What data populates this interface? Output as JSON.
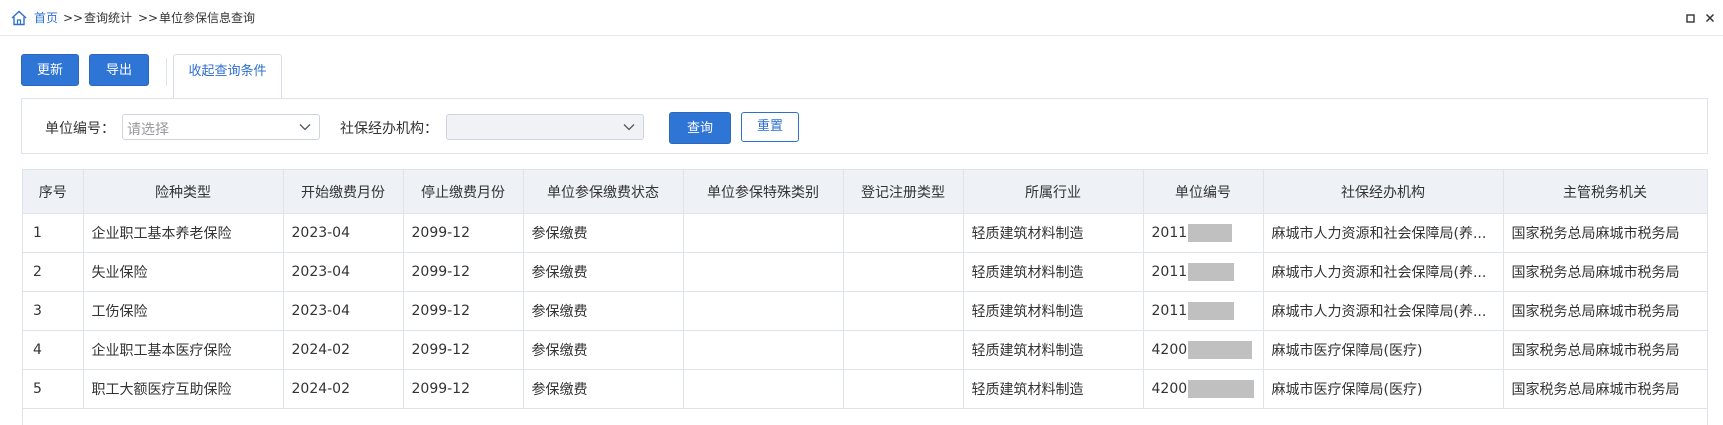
{
  "breadcrumb": {
    "home": "首页",
    "sep1": ">>",
    "level2": "查询统计",
    "sep2": ">>",
    "current": "单位参保信息查询"
  },
  "toolbar": {
    "refresh_label": "更新",
    "export_label": "导出",
    "collapse_tab_label": "收起查询条件"
  },
  "query": {
    "unit_no_label": "单位编号：",
    "unit_no_placeholder": "请选择",
    "agency_label": "社保经办机构：",
    "agency_value": "",
    "search_label": "查询",
    "reset_label": "重置"
  },
  "table": {
    "columns": [
      "序号",
      "险种类型",
      "开始缴费月份",
      "停止缴费月份",
      "单位参保缴费状态",
      "单位参保特殊类别",
      "登记注册类型",
      "所属行业",
      "单位编号",
      "社保经办机构",
      "主管税务机关"
    ],
    "rows": [
      {
        "no": "1",
        "type": "企业职工基本养老保险",
        "start": "2023-04",
        "stop": "2099-12",
        "status": "参保缴费",
        "special": "",
        "reg_type": "",
        "industry": "轻质建筑材料制造",
        "unit_no": "2011",
        "agency": "麻城市人力资源和社会保障局(养...",
        "tax": "国家税务总局麻城市税务局"
      },
      {
        "no": "2",
        "type": "失业保险",
        "start": "2023-04",
        "stop": "2099-12",
        "status": "参保缴费",
        "special": "",
        "reg_type": "",
        "industry": "轻质建筑材料制造",
        "unit_no": "2011",
        "agency": "麻城市人力资源和社会保障局(养...",
        "tax": "国家税务总局麻城市税务局"
      },
      {
        "no": "3",
        "type": "工伤保险",
        "start": "2023-04",
        "stop": "2099-12",
        "status": "参保缴费",
        "special": "",
        "reg_type": "",
        "industry": "轻质建筑材料制造",
        "unit_no": "2011",
        "agency": "麻城市人力资源和社会保障局(养...",
        "tax": "国家税务总局麻城市税务局"
      },
      {
        "no": "4",
        "type": "企业职工基本医疗保险",
        "start": "2024-02",
        "stop": "2099-12",
        "status": "参保缴费",
        "special": "",
        "reg_type": "",
        "industry": "轻质建筑材料制造",
        "unit_no": "4200",
        "agency": "麻城市医疗保障局(医疗)",
        "tax": "国家税务总局麻城市税务局"
      },
      {
        "no": "5",
        "type": "职工大额医疗互助保险",
        "start": "2024-02",
        "stop": "2099-12",
        "status": "参保缴费",
        "special": "",
        "reg_type": "",
        "industry": "轻质建筑材料制造",
        "unit_no": "4200",
        "agency": "麻城市医疗保障局(医疗)",
        "tax": "国家税务总局麻城市税务局"
      }
    ]
  },
  "icons": {
    "home": "home-icon",
    "window": "restore-icon",
    "close": "close-icon",
    "dropdown": "chevron-down-icon"
  },
  "colors": {
    "primary": "#2f75d6",
    "link": "#2f6fd0",
    "header_bg": "#eef1f5",
    "redaction": "#c0c0c0"
  }
}
